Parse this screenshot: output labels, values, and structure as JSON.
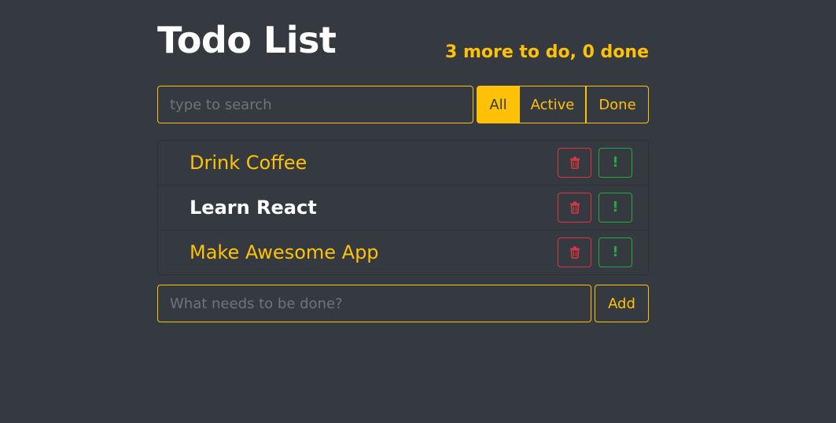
{
  "header": {
    "title": "Todo List",
    "counter": "3 more to do, 0 done"
  },
  "search": {
    "placeholder": "type to search",
    "value": ""
  },
  "filters": [
    {
      "label": "All",
      "active": true
    },
    {
      "label": "Active",
      "active": false
    },
    {
      "label": "Done",
      "active": false
    }
  ],
  "todos": [
    {
      "label": "Drink Coffee",
      "important": false,
      "done": false
    },
    {
      "label": "Learn React",
      "important": true,
      "done": false
    },
    {
      "label": "Make Awesome App",
      "important": false,
      "done": false
    }
  ],
  "add_form": {
    "placeholder": "What needs to be done?",
    "value": "",
    "button_label": "Add"
  },
  "icons": {
    "delete": "trash-icon",
    "important": "exclamation-icon"
  },
  "colors": {
    "background": "#343a40",
    "accent": "#ffc107",
    "danger": "#dc3545",
    "success": "#28a745",
    "text": "#ffffff"
  }
}
